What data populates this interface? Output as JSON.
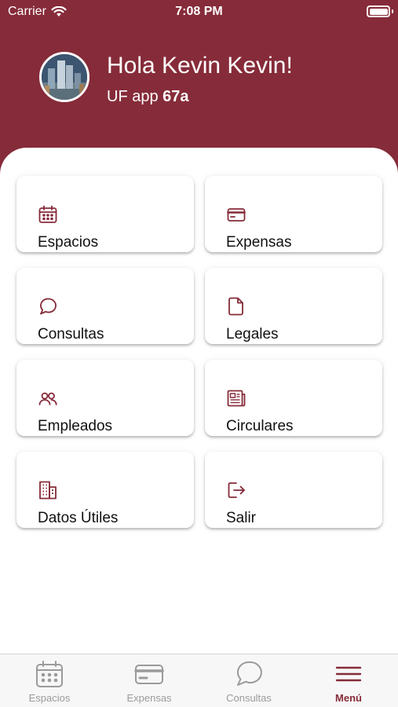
{
  "status_bar": {
    "carrier": "Carrier",
    "time": "7:08 PM"
  },
  "header": {
    "greeting": "Hola Kevin Kevin!",
    "unit_prefix": "UF app",
    "unit_value": "67a"
  },
  "menu": {
    "items": [
      {
        "label": "Espacios",
        "icon": "calendar-icon"
      },
      {
        "label": "Expensas",
        "icon": "credit-card-icon"
      },
      {
        "label": "Consultas",
        "icon": "chat-bubble-icon"
      },
      {
        "label": "Legales",
        "icon": "document-icon"
      },
      {
        "label": "Empleados",
        "icon": "users-icon"
      },
      {
        "label": "Circulares",
        "icon": "newspaper-icon"
      },
      {
        "label": "Datos Útiles",
        "icon": "building-icon"
      },
      {
        "label": "Salir",
        "icon": "logout-icon"
      }
    ]
  },
  "tabbar": {
    "tabs": [
      {
        "label": "Espacios",
        "icon": "calendar-icon",
        "active": false
      },
      {
        "label": "Expensas",
        "icon": "credit-card-icon",
        "active": false
      },
      {
        "label": "Consultas",
        "icon": "chat-bubble-icon",
        "active": false
      },
      {
        "label": "Menú",
        "icon": "menu-icon",
        "active": true
      }
    ]
  },
  "colors": {
    "brand": "#862b39",
    "inactive_tab": "#9b9b9b",
    "background": "#ffffff"
  }
}
